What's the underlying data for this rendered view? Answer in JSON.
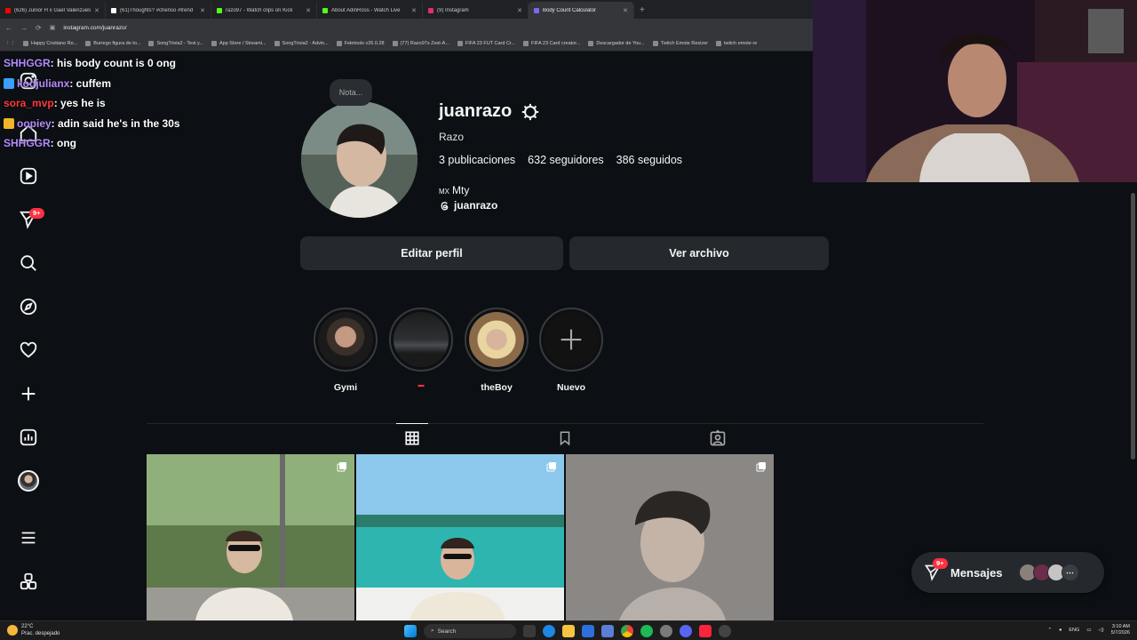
{
  "browser": {
    "tabs": [
      {
        "title": "(626) Junior H x Gael Valenzuela",
        "color": "#ff0000"
      },
      {
        "title": "(61)Thoughts? #chenso #trend",
        "color": "#ffffff"
      },
      {
        "title": "razo97 - Watch clips on Kick",
        "color": "#53fc18"
      },
      {
        "title": "About AdinRoss - Watch Live",
        "color": "#53fc18"
      },
      {
        "title": "(9) Instagram",
        "color": "#e1306c"
      },
      {
        "title": "Body Count Calculator",
        "color": "#7b68ee"
      }
    ],
    "active_tab": 5,
    "url": "instagram.com/juanrazo/",
    "bookmarks": [
      "Happy Cristiano Ro...",
      "Burrego figura de to...",
      "SongTrivia2 - Test y...",
      "App Store / Streami...",
      "SongTrivia2 - Advin...",
      "Feletools v26.0.28",
      "(77) Razo97s Zest-A...",
      "FIFA 23 FUT Card Cr...",
      "FIFA 23 Card creator...",
      "Descargador de You...",
      "Twitch Emote Resizer",
      "twitch emote re"
    ]
  },
  "chat": [
    {
      "user": "SHHGGR",
      "text": ": his body count is 0 ong",
      "color": "#b58bff",
      "icon": ""
    },
    {
      "user": "kodjulianx",
      "text": ": cuffem",
      "color": "#b58bff",
      "icon": "#3aa0ff"
    },
    {
      "user": "sora_mvp",
      "text": ": yes he is",
      "color": "#ff3a3a",
      "icon": ""
    },
    {
      "user": "oopiey",
      "text": ": adin said he's in the 30s",
      "color": "#b58bff",
      "icon": "#f0b429"
    },
    {
      "user": "SHHGGR",
      "text": ": ong",
      "color": "#b58bff",
      "icon": ""
    }
  ],
  "sidebar": {
    "badge": "9+"
  },
  "profile": {
    "note": "Nota...",
    "username": "juanrazo",
    "full_name": "Razo",
    "posts": "3 publicaciones",
    "followers": "632 seguidores",
    "following": "386 seguidos",
    "bio_flag": "MX",
    "bio_location": "Mty",
    "threads_handle": "juanrazo",
    "edit_button": "Editar perfil",
    "archive_button": "Ver archivo"
  },
  "highlights": [
    {
      "label": "Gymi"
    },
    {
      "label": "▬"
    },
    {
      "label": "theBoy"
    },
    {
      "label": "Nuevo"
    }
  ],
  "messages": {
    "label": "Mensajes",
    "badge": "9+"
  },
  "taskbar": {
    "temp": "22°C",
    "weather": "Prac. despejado",
    "search": "Search",
    "lang": "ENG",
    "time": "3:10 AM",
    "date": "5/7/2026"
  },
  "colors": {
    "background": "#0c1014",
    "button": "#25292e",
    "badge": "#ff3040"
  }
}
